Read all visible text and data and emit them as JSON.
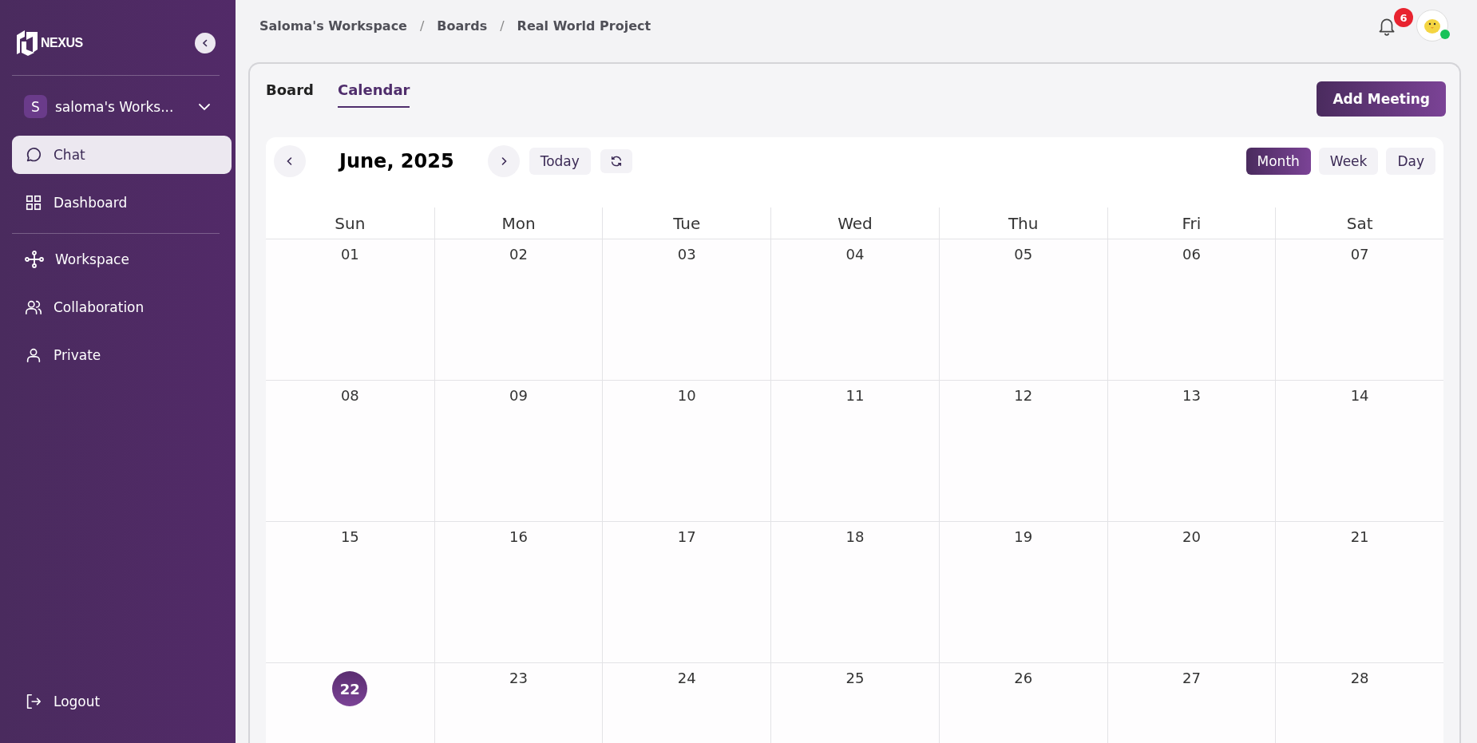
{
  "sidebar": {
    "logo_text": "NEXUS",
    "workspace": {
      "initial": "S",
      "name": "saloma's Works..."
    },
    "nav_primary": [
      {
        "label": "Chat",
        "selected": true
      },
      {
        "label": "Dashboard",
        "selected": false
      }
    ],
    "nav_secondary": [
      {
        "label": "Workspace",
        "selected": false
      },
      {
        "label": "Collaboration",
        "selected": false
      },
      {
        "label": "Private",
        "selected": false
      }
    ],
    "logout": "Logout"
  },
  "breadcrumbs": [
    {
      "label": "Saloma's Workspace"
    },
    {
      "separator": "/",
      "label": "Boards"
    },
    {
      "separator": "/",
      "label": "Real World Project"
    }
  ],
  "notifications": {
    "count": "6"
  },
  "user": {
    "online": true
  },
  "tabs": [
    {
      "label": "Board",
      "selected": false
    },
    {
      "label": "Calendar",
      "selected": true
    }
  ],
  "add_button": "Add Meeting",
  "calendar": {
    "title": "June, 2025",
    "today_button": "Today",
    "views": [
      {
        "label": "Month",
        "selected": true
      },
      {
        "label": "Week",
        "selected": false
      },
      {
        "label": "Day",
        "selected": false
      }
    ],
    "weekdays": [
      "Sun",
      "Mon",
      "Tue",
      "Wed",
      "Thu",
      "Fri",
      "Sat"
    ],
    "weeks": [
      [
        {
          "label": "01",
          "today": false
        },
        {
          "label": "02",
          "today": false
        },
        {
          "label": "03",
          "today": false
        },
        {
          "label": "04",
          "today": false
        },
        {
          "label": "05",
          "today": false
        },
        {
          "label": "06",
          "today": false
        },
        {
          "label": "07",
          "today": false
        }
      ],
      [
        {
          "label": "08",
          "today": false
        },
        {
          "label": "09",
          "today": false
        },
        {
          "label": "10",
          "today": false
        },
        {
          "label": "11",
          "today": false
        },
        {
          "label": "12",
          "today": false
        },
        {
          "label": "13",
          "today": false
        },
        {
          "label": "14",
          "today": false
        }
      ],
      [
        {
          "label": "15",
          "today": false
        },
        {
          "label": "16",
          "today": false
        },
        {
          "label": "17",
          "today": false
        },
        {
          "label": "18",
          "today": false
        },
        {
          "label": "19",
          "today": false
        },
        {
          "label": "20",
          "today": false
        },
        {
          "label": "21",
          "today": false
        }
      ],
      [
        {
          "label": "22",
          "today": true
        },
        {
          "label": "23",
          "today": false
        },
        {
          "label": "24",
          "today": false
        },
        {
          "label": "25",
          "today": false
        },
        {
          "label": "26",
          "today": false
        },
        {
          "label": "27",
          "today": false
        },
        {
          "label": "28",
          "today": false
        }
      ]
    ]
  }
}
